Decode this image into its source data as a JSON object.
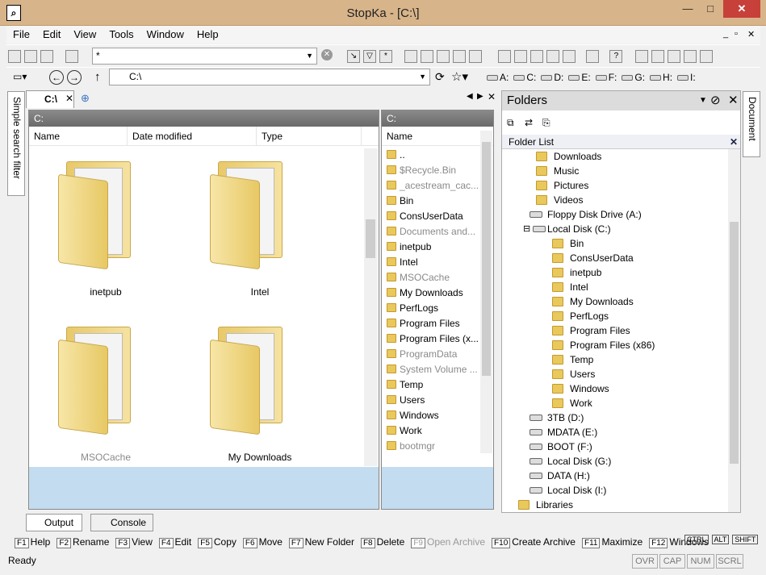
{
  "window": {
    "title": "StopKa - [C:\\]",
    "min": "—",
    "max": "□",
    "close": "✕"
  },
  "menu": [
    "File",
    "Edit",
    "View",
    "Tools",
    "Window",
    "Help"
  ],
  "mdi_controls": [
    "_",
    "▫",
    "✕"
  ],
  "filter": {
    "value": "*"
  },
  "address": {
    "value": "C:\\"
  },
  "drives": [
    "A:",
    "C:",
    "D:",
    "E:",
    "F:",
    "G:",
    "H:",
    "I:"
  ],
  "left_sidebar_tab": "Simple search filter",
  "right_sidebar_tab": "Document",
  "tab": {
    "label": "C:\\"
  },
  "left_pane": {
    "header": "C:",
    "columns": [
      "Name",
      "Date modified",
      "Type"
    ],
    "items": [
      {
        "name": "inetpub",
        "hidden": false
      },
      {
        "name": "Intel",
        "hidden": false
      },
      {
        "name": "MSOCache",
        "hidden": true
      },
      {
        "name": "My Downloads",
        "hidden": false
      }
    ]
  },
  "mid_pane": {
    "header": "C:",
    "column": "Name",
    "items": [
      {
        "name": "..",
        "hidden": false
      },
      {
        "name": "$Recycle.Bin",
        "hidden": true
      },
      {
        "name": "_acestream_cac...",
        "hidden": true
      },
      {
        "name": "Bin",
        "hidden": false
      },
      {
        "name": "ConsUserData",
        "hidden": false
      },
      {
        "name": "Documents and...",
        "hidden": true
      },
      {
        "name": "inetpub",
        "hidden": false
      },
      {
        "name": "Intel",
        "hidden": false
      },
      {
        "name": "MSOCache",
        "hidden": true
      },
      {
        "name": "My Downloads",
        "hidden": false
      },
      {
        "name": "PerfLogs",
        "hidden": false
      },
      {
        "name": "Program Files",
        "hidden": false
      },
      {
        "name": "Program Files (x...",
        "hidden": false
      },
      {
        "name": "ProgramData",
        "hidden": true
      },
      {
        "name": "System Volume ...",
        "hidden": true
      },
      {
        "name": "Temp",
        "hidden": false
      },
      {
        "name": "Users",
        "hidden": false
      },
      {
        "name": "Windows",
        "hidden": false
      },
      {
        "name": "Work",
        "hidden": false
      },
      {
        "name": "bootmgr",
        "hidden": true
      }
    ]
  },
  "folders_panel": {
    "title": "Folders",
    "list_title": "Folder List",
    "tree": [
      {
        "label": "Downloads",
        "level": 2,
        "kind": "folder"
      },
      {
        "label": "Music",
        "level": 2,
        "kind": "folder"
      },
      {
        "label": "Pictures",
        "level": 2,
        "kind": "folder"
      },
      {
        "label": "Videos",
        "level": 2,
        "kind": "folder"
      },
      {
        "label": "Floppy Disk Drive (A:)",
        "level": 1,
        "kind": "drive"
      },
      {
        "label": "Local Disk (C:)",
        "level": 1,
        "kind": "drive",
        "expander": "⊟"
      },
      {
        "label": "Bin",
        "level": 3,
        "kind": "folder"
      },
      {
        "label": "ConsUserData",
        "level": 3,
        "kind": "folder"
      },
      {
        "label": "inetpub",
        "level": 3,
        "kind": "folder"
      },
      {
        "label": "Intel",
        "level": 3,
        "kind": "folder"
      },
      {
        "label": "My Downloads",
        "level": 3,
        "kind": "folder"
      },
      {
        "label": "PerfLogs",
        "level": 3,
        "kind": "folder"
      },
      {
        "label": "Program Files",
        "level": 3,
        "kind": "folder"
      },
      {
        "label": "Program Files (x86)",
        "level": 3,
        "kind": "folder"
      },
      {
        "label": "Temp",
        "level": 3,
        "kind": "folder"
      },
      {
        "label": "Users",
        "level": 3,
        "kind": "folder"
      },
      {
        "label": "Windows",
        "level": 3,
        "kind": "folder"
      },
      {
        "label": "Work",
        "level": 3,
        "kind": "folder"
      },
      {
        "label": "3TB (D:)",
        "level": 1,
        "kind": "drive"
      },
      {
        "label": "MDATA (E:)",
        "level": 1,
        "kind": "drive"
      },
      {
        "label": "BOOT (F:)",
        "level": 1,
        "kind": "drive"
      },
      {
        "label": "Local Disk (G:)",
        "level": 1,
        "kind": "drive"
      },
      {
        "label": "DATA (H:)",
        "level": 1,
        "kind": "drive"
      },
      {
        "label": "Local Disk (I:)",
        "level": 1,
        "kind": "drive"
      },
      {
        "label": "Libraries",
        "level": 0,
        "kind": "folder"
      }
    ]
  },
  "bottom_tabs": [
    "Output",
    "Console"
  ],
  "fkeys": [
    {
      "key": "F1",
      "label": "Help"
    },
    {
      "key": "F2",
      "label": "Rename"
    },
    {
      "key": "F3",
      "label": "View"
    },
    {
      "key": "F4",
      "label": "Edit"
    },
    {
      "key": "F5",
      "label": "Copy"
    },
    {
      "key": "F6",
      "label": "Move"
    },
    {
      "key": "F7",
      "label": "New Folder"
    },
    {
      "key": "F8",
      "label": "Delete"
    },
    {
      "key": "F9",
      "label": "Open Archive",
      "disabled": true
    },
    {
      "key": "F10",
      "label": "Create Archive"
    },
    {
      "key": "F11",
      "label": "Maximize"
    },
    {
      "key": "F12",
      "label": "Windows"
    }
  ],
  "mod_keys": [
    "CTRL",
    "ALT",
    "SHIFT"
  ],
  "status": {
    "text": "Ready",
    "indicators": [
      "OVR",
      "CAP",
      "NUM",
      "SCRL"
    ]
  }
}
